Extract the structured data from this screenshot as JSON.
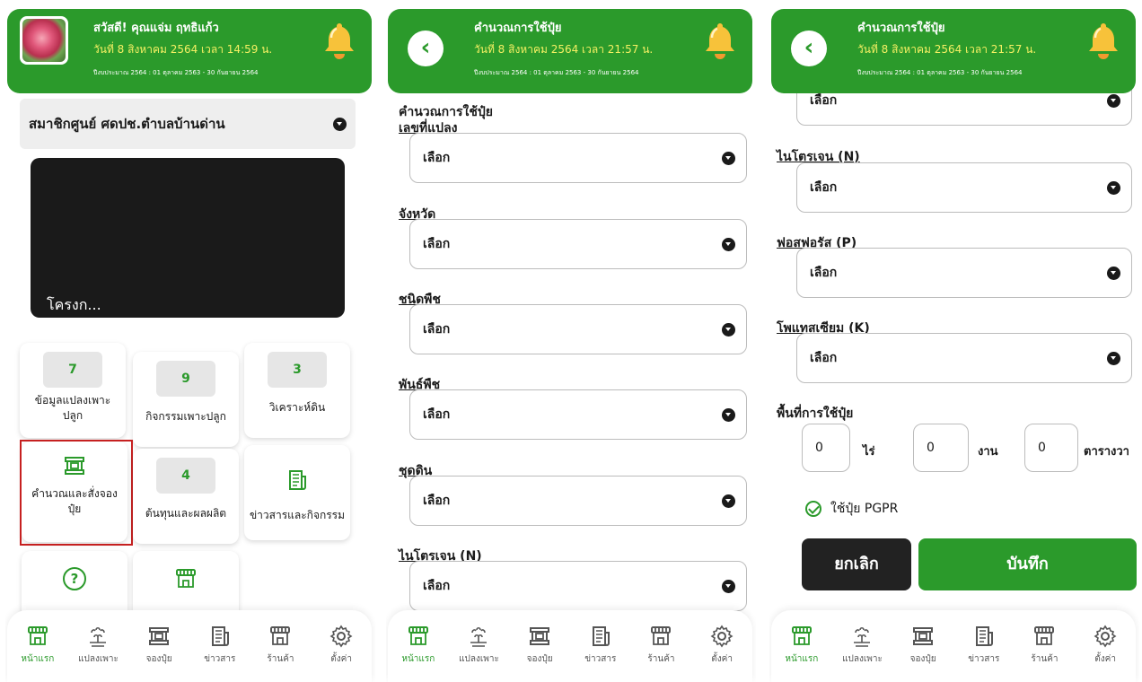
{
  "screen1": {
    "greeting": "สวัสดี! คุณแจ่ม ฤทธิแก้ว",
    "date": "วันที่ 8 สิงหาคม 2564 เวลา 14:59 น.",
    "fiscal_year": "ปีงบประมาณ 2564 : 01 ตุลาคม 2563 - 30 กันยายน 2564",
    "member_select": "สมาชิกศูนย์ ศดปช.ตำบลบ้านด่าน",
    "video_caption": "โครงก...",
    "tiles": [
      {
        "count": "7",
        "label": "ข้อมูลแปลงเพาะปลูก"
      },
      {
        "count": "9",
        "label": "กิจกรรมเพาะปลูก"
      },
      {
        "count": "3",
        "label": "วิเคราะห์ดิน"
      },
      {
        "label": "คำนวณและสั่งจองปุ๋ย"
      },
      {
        "count": "4",
        "label": "ต้นทุนและผลผลิต"
      },
      {
        "label": "ข่าวสารและกิจกรรม"
      }
    ]
  },
  "screen2": {
    "title": "คำนวณการใช้ปุ๋ย",
    "date": "วันที่ 8 สิงหาคม 2564 เวลา 21:57 น.",
    "fiscal_year": "ปีงบประมาณ 2564 : 01 ตุลาคม 2563 - 30 กันยายน 2564",
    "section_title": "คำนวณการใช้ปุ๋ย",
    "fields": [
      {
        "label": "เลขที่แปลง",
        "value": "เลือก"
      },
      {
        "label": "จังหวัด",
        "value": "เลือก"
      },
      {
        "label": "ชนิดพืช",
        "value": "เลือก"
      },
      {
        "label": "พันธ์พืช",
        "value": "เลือก"
      },
      {
        "label": "ชุดดิน",
        "value": "เลือก"
      },
      {
        "label": "ไนโตรเจน (N)",
        "value": "เลือก"
      }
    ]
  },
  "screen3": {
    "title": "คำนวณการใช้ปุ๋ย",
    "date": "วันที่ 8 สิงหาคม 2564 เวลา 21:57 น.",
    "fiscal_year": "ปีงบประมาณ 2564 : 01 ตุลาคม 2563 - 30 กันยายน 2564",
    "partial_value": "เลือก",
    "fields": [
      {
        "label": "ไนโตรเจน (N)",
        "value": "เลือก"
      },
      {
        "label": "ฟอสฟอรัส (P)",
        "value": "เลือก"
      },
      {
        "label": "โพแทสเซียม (K)",
        "value": "เลือก"
      }
    ],
    "area_label": "พื้นที่การใช้ปุ๋ย",
    "area": [
      {
        "value": "0",
        "unit": "ไร่"
      },
      {
        "value": "0",
        "unit": "งาน"
      },
      {
        "value": "0",
        "unit": "ตารางวา"
      }
    ],
    "pgpr_label": "ใช้ปุ๋ย PGPR",
    "cancel_label": "ยกเลิก",
    "save_label": "บันทึก"
  },
  "nav": [
    {
      "label": "หน้าแรก",
      "icon": "home-icon"
    },
    {
      "label": "แปลงเพาะ",
      "icon": "plant-icon"
    },
    {
      "label": "จองปุ๋ย",
      "icon": "fertilizer-icon"
    },
    {
      "label": "ข่าวสาร",
      "icon": "news-icon"
    },
    {
      "label": "ร้านค้า",
      "icon": "store-icon"
    },
    {
      "label": "ตั้งค่า",
      "icon": "gear-icon"
    }
  ],
  "colors": {
    "primary": "#2b9a2b",
    "date_yellow": "#f5f063",
    "dark": "#1a1a1a",
    "highlight": "#c62020"
  }
}
